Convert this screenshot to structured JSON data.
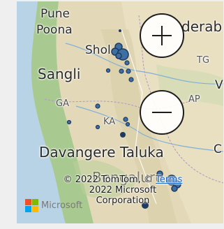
{
  "map": {
    "labels": {
      "pune": "Pune",
      "poona": "Poona",
      "hyderabad_partial": "derab",
      "sholapur_partial": "Shol",
      "tg": "TG",
      "sangli": "Sangli",
      "ap": "AP",
      "ga": "GA",
      "ka": "KA",
      "davangere": "Davangere Taluka",
      "bengaluru_partial": "Bengaluru",
      "edge_v": "V",
      "edge_c": "C"
    },
    "zoom_in_symbol": "+",
    "zoom_out_symbol": "−",
    "attribution": {
      "line1": "© 2022 TomTom, © ",
      "terms": "Terms",
      "line2": "2022 Microsoft",
      "line3": "Corporation"
    },
    "logo": {
      "text": "Microsoft",
      "colors": [
        "#f25022",
        "#7fba00",
        "#00a4ef",
        "#ffb900"
      ]
    },
    "marker_color": "#1f3a5f",
    "marker_fill": "#3d6fa3"
  }
}
